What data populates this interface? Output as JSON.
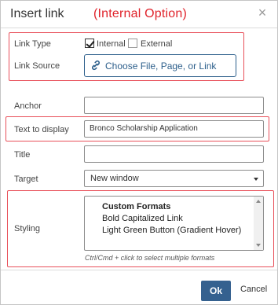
{
  "dialog": {
    "title": "Insert link",
    "annotation": "(Internal Option)",
    "close_glyph": "×"
  },
  "link_type": {
    "label": "Link Type",
    "options": [
      {
        "label": "Internal",
        "checked": true
      },
      {
        "label": "External",
        "checked": false
      }
    ]
  },
  "link_source": {
    "label": "Link Source",
    "button_label": "Choose File, Page, or Link",
    "icon": "link-icon"
  },
  "anchor": {
    "label": "Anchor",
    "value": ""
  },
  "text_to_display": {
    "label": "Text to display",
    "value": "Bronco Scholarship Application"
  },
  "title_field": {
    "label": "Title",
    "value": ""
  },
  "target": {
    "label": "Target",
    "value": "New window"
  },
  "styling": {
    "label": "Styling",
    "group": "Custom Formats",
    "options": [
      "Bold Capitalized Link",
      "Light Green Button (Gradient Hover)"
    ],
    "hint": "Ctrl/Cmd + click to select multiple formats"
  },
  "footer": {
    "ok_label": "Ok",
    "cancel_label": "Cancel"
  },
  "colors": {
    "annotation_red": "#e0232b",
    "highlight_box": "#e8505a",
    "primary_blue": "#35618f",
    "link_blue": "#2d5f8b"
  }
}
